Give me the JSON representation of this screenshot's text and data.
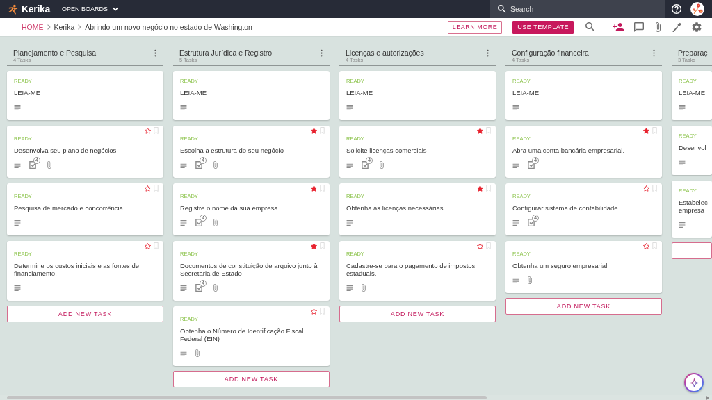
{
  "top_bar": {
    "logo": "Kerika",
    "boards_menu": "OPEN BOARDS",
    "search": {
      "placeholder": "Search"
    }
  },
  "sub_bar": {
    "breadcrumb": [
      {
        "label": "HOME",
        "kind": "link"
      },
      {
        "label": "Kerika",
        "kind": "crumb"
      },
      {
        "label": "Abrindo um novo negócio no estado de Washington",
        "kind": "crumb"
      }
    ],
    "buttons": [
      {
        "label": "LEARN MORE",
        "kind": "outline"
      },
      {
        "label": "USE TEMPLATE",
        "kind": "filled"
      }
    ]
  },
  "columns": [
    {
      "title": "Planejamento e Pesquisa",
      "count": "4 Tasks",
      "menu": true,
      "cards": [
        {
          "status": "READY",
          "title": "LEIA-ME",
          "badges": [
            {
              "kind": "description"
            }
          ]
        },
        {
          "starred": false,
          "status": "READY",
          "title": "Desenvolva seu plano de negócios",
          "badges": [
            {
              "kind": "description"
            },
            {
              "kind": "checklist",
              "count": "4"
            },
            {
              "kind": "attachment"
            }
          ]
        },
        {
          "starred": false,
          "status": "READY",
          "title": "Pesquisa de mercado e concorrência",
          "badges": [
            {
              "kind": "description"
            }
          ]
        },
        {
          "starred": false,
          "status": "READY",
          "title": "Determine os custos iniciais e as fontes de financiamento.",
          "badges": [
            {
              "kind": "description"
            }
          ]
        }
      ],
      "add_label": "ADD NEW TASK"
    },
    {
      "title": "Estrutura Jurídica e Registro",
      "count": "5 Tasks",
      "menu": true,
      "cards": [
        {
          "status": "READY",
          "title": "LEIA-ME",
          "badges": [
            {
              "kind": "description"
            }
          ]
        },
        {
          "starred": true,
          "status": "READY",
          "title": "Escolha a estrutura do seu negócio",
          "badges": [
            {
              "kind": "description"
            },
            {
              "kind": "checklist",
              "count": "4"
            },
            {
              "kind": "attachment"
            }
          ]
        },
        {
          "starred": true,
          "status": "READY",
          "title": "Registre o nome da sua empresa",
          "badges": [
            {
              "kind": "description"
            },
            {
              "kind": "checklist",
              "count": "4"
            },
            {
              "kind": "attachment"
            }
          ]
        },
        {
          "starred": true,
          "status": "READY",
          "title": "Documentos de constituição de arquivo junto à Secretaria de Estado",
          "badges": [
            {
              "kind": "description"
            },
            {
              "kind": "checklist",
              "count": "4"
            },
            {
              "kind": "attachment"
            }
          ]
        },
        {
          "starred": false,
          "status": "READY",
          "title": "Obtenha o Número de Identificação Fiscal Federal (EIN)",
          "badges": [
            {
              "kind": "description"
            },
            {
              "kind": "attachment"
            }
          ]
        }
      ],
      "add_label": "ADD NEW TASK"
    },
    {
      "title": "Licenças e autorizações",
      "count": "4 Tasks",
      "menu": true,
      "cards": [
        {
          "status": "READY",
          "title": "LEIA-ME",
          "badges": [
            {
              "kind": "description"
            }
          ]
        },
        {
          "starred": true,
          "status": "READY",
          "title": "Solicite licenças comerciais",
          "badges": [
            {
              "kind": "description"
            },
            {
              "kind": "checklist",
              "count": "4"
            },
            {
              "kind": "attachment"
            }
          ]
        },
        {
          "starred": true,
          "status": "READY",
          "title": "Obtenha as licenças necessárias",
          "badges": [
            {
              "kind": "description"
            }
          ]
        },
        {
          "starred": false,
          "status": "READY",
          "title": "Cadastre-se para o pagamento de impostos estaduais.",
          "badges": [
            {
              "kind": "description"
            },
            {
              "kind": "attachment"
            }
          ]
        }
      ],
      "add_label": "ADD NEW TASK"
    },
    {
      "title": "Configuração financeira",
      "count": "4 Tasks",
      "menu": true,
      "cards": [
        {
          "status": "READY",
          "title": "LEIA-ME",
          "badges": [
            {
              "kind": "description"
            }
          ]
        },
        {
          "starred": true,
          "status": "READY",
          "title": "Abra uma conta bancária empresarial.",
          "badges": [
            {
              "kind": "description"
            },
            {
              "kind": "checklist",
              "count": "4"
            }
          ]
        },
        {
          "starred": false,
          "status": "READY",
          "title": "Configurar sistema de contabilidade",
          "badges": [
            {
              "kind": "description"
            },
            {
              "kind": "checklist",
              "count": "4"
            }
          ]
        },
        {
          "starred": false,
          "status": "READY",
          "title": "Obtenha um seguro empresarial",
          "badges": [
            {
              "kind": "description"
            },
            {
              "kind": "attachment"
            }
          ]
        }
      ],
      "add_label": "ADD NEW TASK"
    },
    {
      "title": "Preparaç",
      "count": "3 Tasks",
      "cards": [
        {
          "status": "READY",
          "title": "LEIA-ME",
          "badges": [
            {
              "kind": "description"
            }
          ]
        },
        {
          "status": "READY",
          "title": "Desenvol",
          "badges": [
            {
              "kind": "description"
            }
          ]
        },
        {
          "status": "READY",
          "title": "Estabelec\nempresa",
          "badges": [
            {
              "kind": "description"
            }
          ]
        }
      ]
    }
  ]
}
